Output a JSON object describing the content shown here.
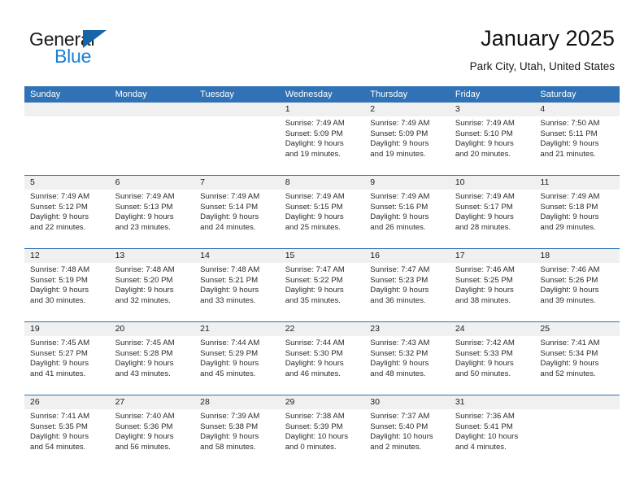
{
  "logo": {
    "word_top": "General",
    "word_bottom": "Blue",
    "triangle_color": "#1565a8",
    "blue_color": "#1a7fd4"
  },
  "header": {
    "title": "January 2025",
    "subtitle": "Park City, Utah, United States"
  },
  "theme": {
    "header_blue": "#3072B5",
    "day_band_gray": "#f0f0f0",
    "text_color": "#2b2b2b"
  },
  "weekdays": [
    "Sunday",
    "Monday",
    "Tuesday",
    "Wednesday",
    "Thursday",
    "Friday",
    "Saturday"
  ],
  "weeks": [
    [
      {
        "day": "",
        "sunrise": "",
        "sunset": "",
        "daylight1": "",
        "daylight2": ""
      },
      {
        "day": "",
        "sunrise": "",
        "sunset": "",
        "daylight1": "",
        "daylight2": ""
      },
      {
        "day": "",
        "sunrise": "",
        "sunset": "",
        "daylight1": "",
        "daylight2": ""
      },
      {
        "day": "1",
        "sunrise": "Sunrise: 7:49 AM",
        "sunset": "Sunset: 5:09 PM",
        "daylight1": "Daylight: 9 hours",
        "daylight2": "and 19 minutes."
      },
      {
        "day": "2",
        "sunrise": "Sunrise: 7:49 AM",
        "sunset": "Sunset: 5:09 PM",
        "daylight1": "Daylight: 9 hours",
        "daylight2": "and 19 minutes."
      },
      {
        "day": "3",
        "sunrise": "Sunrise: 7:49 AM",
        "sunset": "Sunset: 5:10 PM",
        "daylight1": "Daylight: 9 hours",
        "daylight2": "and 20 minutes."
      },
      {
        "day": "4",
        "sunrise": "Sunrise: 7:50 AM",
        "sunset": "Sunset: 5:11 PM",
        "daylight1": "Daylight: 9 hours",
        "daylight2": "and 21 minutes."
      }
    ],
    [
      {
        "day": "5",
        "sunrise": "Sunrise: 7:49 AM",
        "sunset": "Sunset: 5:12 PM",
        "daylight1": "Daylight: 9 hours",
        "daylight2": "and 22 minutes."
      },
      {
        "day": "6",
        "sunrise": "Sunrise: 7:49 AM",
        "sunset": "Sunset: 5:13 PM",
        "daylight1": "Daylight: 9 hours",
        "daylight2": "and 23 minutes."
      },
      {
        "day": "7",
        "sunrise": "Sunrise: 7:49 AM",
        "sunset": "Sunset: 5:14 PM",
        "daylight1": "Daylight: 9 hours",
        "daylight2": "and 24 minutes."
      },
      {
        "day": "8",
        "sunrise": "Sunrise: 7:49 AM",
        "sunset": "Sunset: 5:15 PM",
        "daylight1": "Daylight: 9 hours",
        "daylight2": "and 25 minutes."
      },
      {
        "day": "9",
        "sunrise": "Sunrise: 7:49 AM",
        "sunset": "Sunset: 5:16 PM",
        "daylight1": "Daylight: 9 hours",
        "daylight2": "and 26 minutes."
      },
      {
        "day": "10",
        "sunrise": "Sunrise: 7:49 AM",
        "sunset": "Sunset: 5:17 PM",
        "daylight1": "Daylight: 9 hours",
        "daylight2": "and 28 minutes."
      },
      {
        "day": "11",
        "sunrise": "Sunrise: 7:49 AM",
        "sunset": "Sunset: 5:18 PM",
        "daylight1": "Daylight: 9 hours",
        "daylight2": "and 29 minutes."
      }
    ],
    [
      {
        "day": "12",
        "sunrise": "Sunrise: 7:48 AM",
        "sunset": "Sunset: 5:19 PM",
        "daylight1": "Daylight: 9 hours",
        "daylight2": "and 30 minutes."
      },
      {
        "day": "13",
        "sunrise": "Sunrise: 7:48 AM",
        "sunset": "Sunset: 5:20 PM",
        "daylight1": "Daylight: 9 hours",
        "daylight2": "and 32 minutes."
      },
      {
        "day": "14",
        "sunrise": "Sunrise: 7:48 AM",
        "sunset": "Sunset: 5:21 PM",
        "daylight1": "Daylight: 9 hours",
        "daylight2": "and 33 minutes."
      },
      {
        "day": "15",
        "sunrise": "Sunrise: 7:47 AM",
        "sunset": "Sunset: 5:22 PM",
        "daylight1": "Daylight: 9 hours",
        "daylight2": "and 35 minutes."
      },
      {
        "day": "16",
        "sunrise": "Sunrise: 7:47 AM",
        "sunset": "Sunset: 5:23 PM",
        "daylight1": "Daylight: 9 hours",
        "daylight2": "and 36 minutes."
      },
      {
        "day": "17",
        "sunrise": "Sunrise: 7:46 AM",
        "sunset": "Sunset: 5:25 PM",
        "daylight1": "Daylight: 9 hours",
        "daylight2": "and 38 minutes."
      },
      {
        "day": "18",
        "sunrise": "Sunrise: 7:46 AM",
        "sunset": "Sunset: 5:26 PM",
        "daylight1": "Daylight: 9 hours",
        "daylight2": "and 39 minutes."
      }
    ],
    [
      {
        "day": "19",
        "sunrise": "Sunrise: 7:45 AM",
        "sunset": "Sunset: 5:27 PM",
        "daylight1": "Daylight: 9 hours",
        "daylight2": "and 41 minutes."
      },
      {
        "day": "20",
        "sunrise": "Sunrise: 7:45 AM",
        "sunset": "Sunset: 5:28 PM",
        "daylight1": "Daylight: 9 hours",
        "daylight2": "and 43 minutes."
      },
      {
        "day": "21",
        "sunrise": "Sunrise: 7:44 AM",
        "sunset": "Sunset: 5:29 PM",
        "daylight1": "Daylight: 9 hours",
        "daylight2": "and 45 minutes."
      },
      {
        "day": "22",
        "sunrise": "Sunrise: 7:44 AM",
        "sunset": "Sunset: 5:30 PM",
        "daylight1": "Daylight: 9 hours",
        "daylight2": "and 46 minutes."
      },
      {
        "day": "23",
        "sunrise": "Sunrise: 7:43 AM",
        "sunset": "Sunset: 5:32 PM",
        "daylight1": "Daylight: 9 hours",
        "daylight2": "and 48 minutes."
      },
      {
        "day": "24",
        "sunrise": "Sunrise: 7:42 AM",
        "sunset": "Sunset: 5:33 PM",
        "daylight1": "Daylight: 9 hours",
        "daylight2": "and 50 minutes."
      },
      {
        "day": "25",
        "sunrise": "Sunrise: 7:41 AM",
        "sunset": "Sunset: 5:34 PM",
        "daylight1": "Daylight: 9 hours",
        "daylight2": "and 52 minutes."
      }
    ],
    [
      {
        "day": "26",
        "sunrise": "Sunrise: 7:41 AM",
        "sunset": "Sunset: 5:35 PM",
        "daylight1": "Daylight: 9 hours",
        "daylight2": "and 54 minutes."
      },
      {
        "day": "27",
        "sunrise": "Sunrise: 7:40 AM",
        "sunset": "Sunset: 5:36 PM",
        "daylight1": "Daylight: 9 hours",
        "daylight2": "and 56 minutes."
      },
      {
        "day": "28",
        "sunrise": "Sunrise: 7:39 AM",
        "sunset": "Sunset: 5:38 PM",
        "daylight1": "Daylight: 9 hours",
        "daylight2": "and 58 minutes."
      },
      {
        "day": "29",
        "sunrise": "Sunrise: 7:38 AM",
        "sunset": "Sunset: 5:39 PM",
        "daylight1": "Daylight: 10 hours",
        "daylight2": "and 0 minutes."
      },
      {
        "day": "30",
        "sunrise": "Sunrise: 7:37 AM",
        "sunset": "Sunset: 5:40 PM",
        "daylight1": "Daylight: 10 hours",
        "daylight2": "and 2 minutes."
      },
      {
        "day": "31",
        "sunrise": "Sunrise: 7:36 AM",
        "sunset": "Sunset: 5:41 PM",
        "daylight1": "Daylight: 10 hours",
        "daylight2": "and 4 minutes."
      },
      {
        "day": "",
        "sunrise": "",
        "sunset": "",
        "daylight1": "",
        "daylight2": ""
      }
    ]
  ]
}
